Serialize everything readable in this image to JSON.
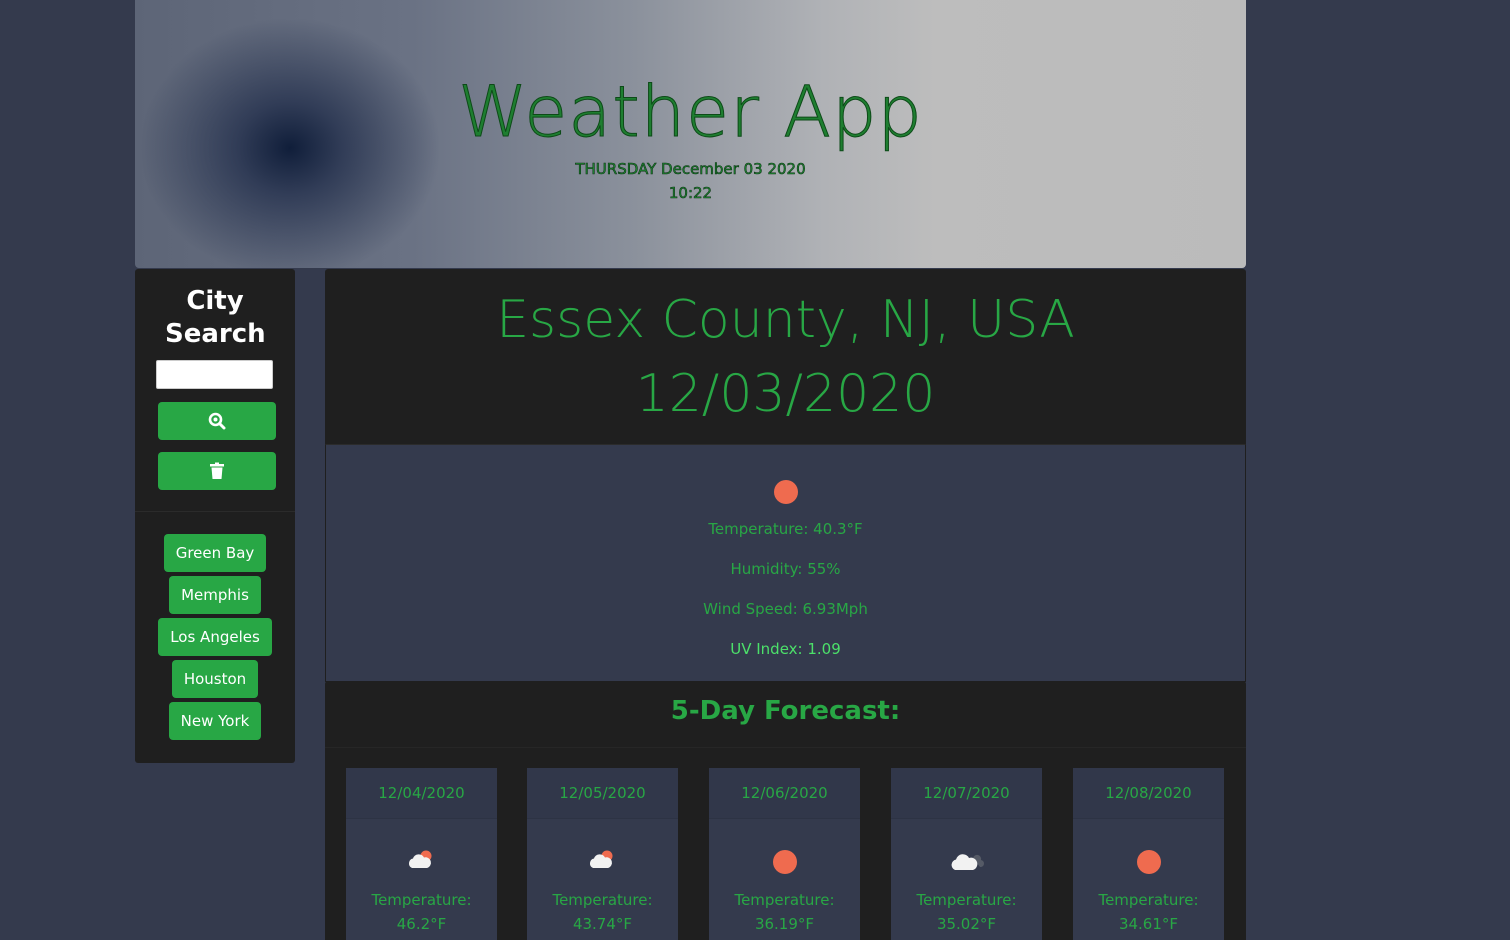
{
  "header": {
    "title": "Weather App",
    "date": "THURSDAY December 03 2020",
    "time": "10:22"
  },
  "sidebar": {
    "title": "City Search",
    "search_placeholder": "",
    "search_icon": "search-icon",
    "clear_icon": "trash-icon",
    "history": [
      "Green Bay",
      "Memphis",
      "Los Angeles",
      "Houston",
      "New York"
    ]
  },
  "current": {
    "city": "Essex County, NJ, USA",
    "date": "12/03/2020",
    "icon": "sun-icon",
    "temperature": "Temperature: 40.3°F",
    "humidity": "Humidity: 55%",
    "wind": "Wind Speed: 6.93Mph",
    "uv": "UV Index: 1.09"
  },
  "forecast": {
    "title": "5-Day Forecast:",
    "label": "Temperature:",
    "days": [
      {
        "date": "12/04/2020",
        "icon": "partly-cloudy-icon",
        "temp": "46.2°F"
      },
      {
        "date": "12/05/2020",
        "icon": "partly-cloudy-icon",
        "temp": "43.74°F"
      },
      {
        "date": "12/06/2020",
        "icon": "sun-icon",
        "temp": "36.19°F"
      },
      {
        "date": "12/07/2020",
        "icon": "cloudy-icon",
        "temp": "35.02°F"
      },
      {
        "date": "12/08/2020",
        "icon": "sun-icon",
        "temp": "34.61°F"
      }
    ]
  },
  "colors": {
    "accent": "#28a745",
    "background": "#343a4d",
    "panel": "#1f1f1f",
    "sun": "#ef6b4f"
  }
}
